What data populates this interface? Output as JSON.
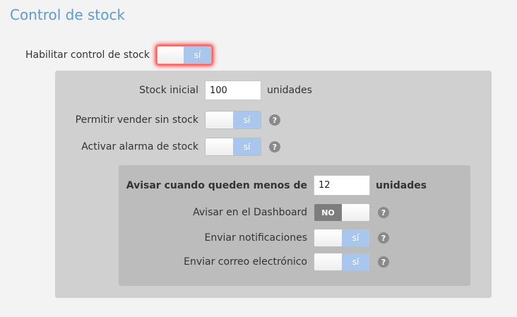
{
  "page": {
    "title": "Control de stock"
  },
  "enable_stock": {
    "label": "Habilitar control de stock",
    "value": "sí"
  },
  "stock_settings": {
    "initial_stock": {
      "label": "Stock inicial",
      "value": "100",
      "unit": "unidades"
    },
    "sell_without_stock": {
      "label": "Permitir vender sin stock",
      "value": "sí",
      "help": "?"
    },
    "stock_alarm": {
      "label": "Activar alarma de stock",
      "value": "sí",
      "help": "?"
    }
  },
  "alarm_settings": {
    "threshold": {
      "label": "Avisar cuando queden menos de",
      "value": "12",
      "unit": "unidades"
    },
    "dashboard": {
      "label": "Avisar en el Dashboard",
      "value": "NO",
      "help": "?"
    },
    "notifications": {
      "label": "Enviar notificaciones",
      "value": "sí",
      "help": "?"
    },
    "email": {
      "label": "Enviar correo electrónico",
      "value": "sí",
      "help": "?"
    }
  },
  "colors": {
    "title": "#5b9bd5",
    "toggle_on": "#a9c7ec",
    "toggle_off": "#7d7d7d",
    "glow": "#ff5a5a"
  }
}
